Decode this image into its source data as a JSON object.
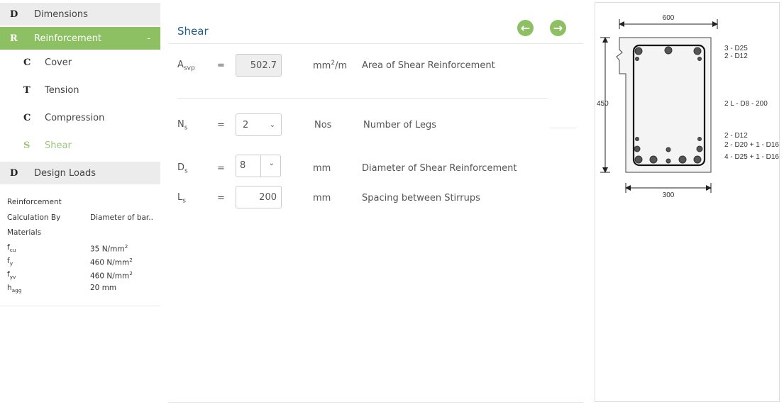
{
  "sidebar": {
    "items": [
      {
        "letter": "D",
        "label": "Dimensions"
      },
      {
        "letter": "R",
        "label": "Reinforcement",
        "toggle": "-"
      },
      {
        "letter": "C",
        "label": "Cover"
      },
      {
        "letter": "T",
        "label": "Tension"
      },
      {
        "letter": "C",
        "label": "Compression"
      },
      {
        "letter": "S",
        "label": "Shear"
      },
      {
        "letter": "D",
        "label": "Design Loads"
      }
    ],
    "summary": {
      "heading": "Reinforcement",
      "calc_label": "Calculation By",
      "calc_value": "Diameter of bar..",
      "materials": "Materials",
      "rows": [
        {
          "sym": "f",
          "sub": "cu",
          "value": "35 N/mm",
          "sup": "2"
        },
        {
          "sym": "f",
          "sub": "y",
          "value": "460 N/mm",
          "sup": "2"
        },
        {
          "sym": "f",
          "sub": "yv",
          "value": "460 N/mm",
          "sup": "2"
        },
        {
          "sym": "h",
          "sub": "agg",
          "value": "20 mm",
          "sup": ""
        }
      ]
    }
  },
  "main": {
    "title": "Shear",
    "eq": "=",
    "asvp": {
      "sym": "A",
      "sub": "svp",
      "value": "502.7",
      "unit": "mm",
      "unit_sup": "2",
      "unit_tail": "/m",
      "desc": "Area of Shear Reinforcement"
    },
    "ns": {
      "sym": "N",
      "sub": "s",
      "value": "2",
      "unit": "Nos",
      "desc": "Number of Legs"
    },
    "ds": {
      "sym": "D",
      "sub": "s",
      "value": "8",
      "unit": "mm",
      "desc": "Diameter of Shear Reinforcement"
    },
    "ls": {
      "sym": "L",
      "sub": "s",
      "value": "200",
      "unit": "mm",
      "desc": "Spacing between Stirrups"
    }
  },
  "diagram": {
    "width": "600",
    "height": "450",
    "web": "300",
    "top1": "3 - D25",
    "top2": "2 - D12",
    "stirrup": "2 L - D8 - 200",
    "bot1": "2 - D12",
    "bot2": "2 - D20 + 1 - D16",
    "bot3": "4 - D25 + 1 - D16"
  },
  "colors": {
    "accent": "#8cc063",
    "title": "#1f5b8a"
  }
}
